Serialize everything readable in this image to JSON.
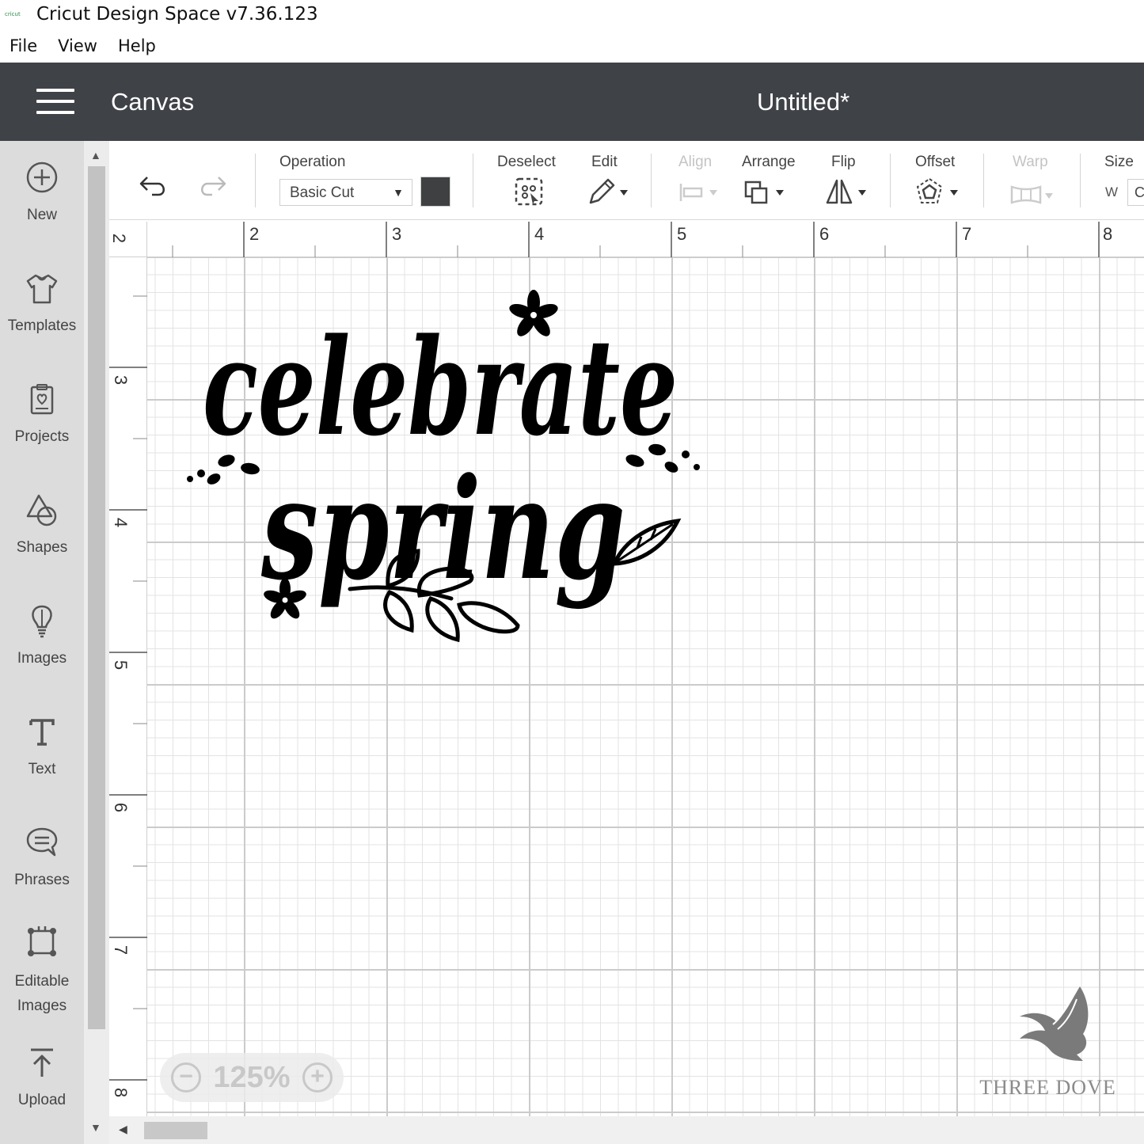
{
  "window": {
    "title": "Cricut Design Space  v7.36.123"
  },
  "menu": [
    "File",
    "View",
    "Help"
  ],
  "header": {
    "section": "Canvas",
    "document_title": "Untitled*"
  },
  "sidebar": {
    "items": [
      {
        "label": "New",
        "icon": "plus-circle-icon"
      },
      {
        "label": "Templates",
        "icon": "tshirt-icon"
      },
      {
        "label": "Projects",
        "icon": "clipboard-icon"
      },
      {
        "label": "Shapes",
        "icon": "shapes-icon"
      },
      {
        "label": "Images",
        "icon": "lightbulb-icon"
      },
      {
        "label": "Text",
        "icon": "text-icon"
      },
      {
        "label": "Phrases",
        "icon": "speech-bubble-icon"
      },
      {
        "label": "Editable\nImages",
        "icon": "editable-image-icon"
      },
      {
        "label": "Upload",
        "icon": "upload-icon"
      }
    ]
  },
  "toolbar": {
    "operation_label": "Operation",
    "operation_value": "Basic Cut",
    "operation_color": "#3f4042",
    "deselect_label": "Deselect",
    "edit_label": "Edit",
    "align_label": "Align",
    "arrange_label": "Arrange",
    "flip_label": "Flip",
    "offset_label": "Offset",
    "warp_label": "Warp",
    "size_label": "Size",
    "size_w_label": "W",
    "size_w_value": "C"
  },
  "ruler": {
    "top": [
      "2",
      "3",
      "4",
      "5",
      "6",
      "7",
      "8"
    ],
    "left": [
      "2",
      "3",
      "4",
      "5",
      "6",
      "7",
      "8"
    ]
  },
  "canvas": {
    "design_text_line1": "celebrate",
    "design_text_line2": "spring"
  },
  "zoom": {
    "value": "125%",
    "minus": "−",
    "plus": "+"
  },
  "watermark": {
    "text": "THREE DOVE"
  },
  "colors": {
    "header_bg": "#3f4247",
    "sidebar_bg": "#dcdcdc",
    "accent_logo": "#2a8a4a"
  }
}
